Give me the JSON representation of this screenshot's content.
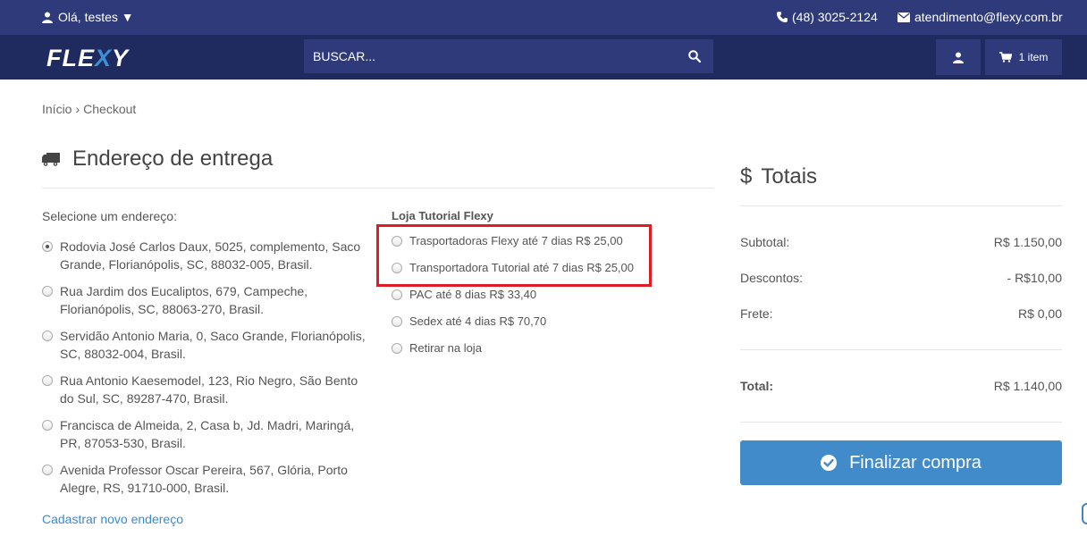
{
  "topbar": {
    "greeting": "Olá, testes ▼",
    "phone": "(48) 3025-2124",
    "email": "atendimento@flexy.com.br"
  },
  "header": {
    "logo_pre": "FLE",
    "logo_x": "X",
    "logo_post": "Y",
    "search_placeholder": "BUSCAR...",
    "cart_label": "1 item"
  },
  "breadcrumb": {
    "home": "Início",
    "current": "Checkout"
  },
  "delivery": {
    "title": "Endereço de entrega",
    "select_label": "Selecione um endereço:",
    "addresses": [
      {
        "text": "Rodovia José Carlos Daux, 5025, complemento, Saco Grande, Florianópolis, SC, 88032-005, Brasil.",
        "checked": true
      },
      {
        "text": "Rua Jardim dos Eucaliptos, 679, Campeche, Florianópolis, SC, 88063-270, Brasil.",
        "checked": false
      },
      {
        "text": "Servidão Antonio Maria, 0, Saco Grande, Florianópolis, SC, 88032-004, Brasil.",
        "checked": false
      },
      {
        "text": "Rua Antonio Kaesemodel, 123, Rio Negro, São Bento do Sul, SC, 89287-470, Brasil.",
        "checked": false
      },
      {
        "text": "Francisca de Almeida, 2, Casa b, Jd. Madri, Maringá, PR, 87053-530, Brasil.",
        "checked": false
      },
      {
        "text": "Avenida Professor Oscar Pereira, 567, Glória, Porto Alegre, RS, 91710-000, Brasil.",
        "checked": false
      }
    ],
    "new_address_link": "Cadastrar novo endereço"
  },
  "shipping": {
    "store_title": "Loja Tutorial Flexy",
    "options": [
      "Trasportadoras Flexy até 7 dias R$ 25,00",
      "Transportadora Tutorial até 7 dias R$ 25,00",
      "PAC até 8 dias R$ 33,40",
      "Sedex até 4 dias R$ 70,70",
      "Retirar na loja"
    ]
  },
  "totals": {
    "title": "Totais",
    "subtotal_label": "Subtotal:",
    "subtotal_value": "R$ 1.150,00",
    "discount_label": "Descontos:",
    "discount_value": "- R$10,00",
    "shipping_label": "Frete:",
    "shipping_value": "R$ 0,00",
    "total_label": "Total:",
    "total_value": "R$ 1.140,00",
    "finish_label": "Finalizar compra"
  },
  "colors": {
    "topbar": "#2f3a7a",
    "header": "#1f2a5e",
    "accent": "#428bca",
    "highlight": "#e01b24"
  }
}
